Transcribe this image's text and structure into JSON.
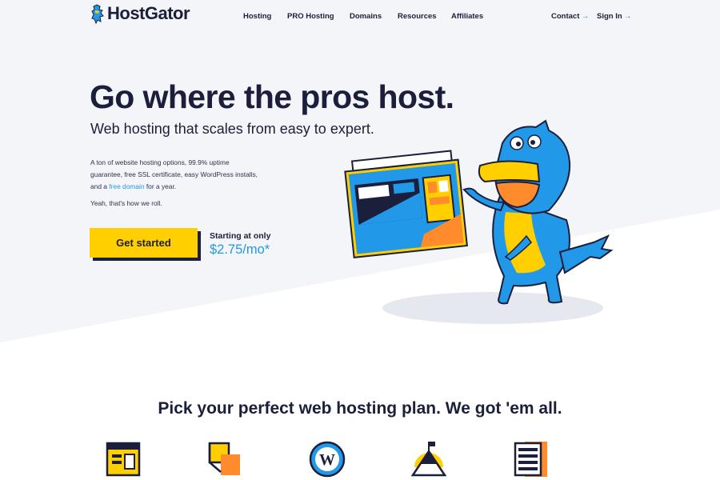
{
  "brand": {
    "name": "HostGator",
    "colors": {
      "navy": "#1b1f3b",
      "blue": "#2199e8",
      "yellow": "#ffcf00",
      "orange": "#ff8b2c",
      "light_bg": "#f4f5f8"
    }
  },
  "nav": {
    "items": [
      "Hosting",
      "PRO Hosting",
      "Domains",
      "Resources",
      "Affiliates"
    ],
    "contact": "Contact",
    "sign_in": "Sign In",
    "arrow_icon": "arrow-right-icon"
  },
  "hero": {
    "title": "Go where the pros host.",
    "subtitle": "Web hosting that scales from easy to expert.",
    "desc_before": "A ton of website hosting options, 99.9% uptime guarantee, free SSL certificate, easy WordPress installs, and a ",
    "desc_link": "free domain",
    "desc_after": " for a year.",
    "tagline": "Yeah, that's how we roll.",
    "cta_label": "Get started",
    "starting_label": "Starting at only",
    "price": "$2.75/mo*"
  },
  "plans": {
    "title": "Pick your perfect web hosting plan. We got 'em all.",
    "icons": [
      "shared-hosting-icon",
      "reseller-hosting-icon",
      "wordpress-icon",
      "vps-mountain-icon",
      "dedicated-server-icon"
    ]
  }
}
